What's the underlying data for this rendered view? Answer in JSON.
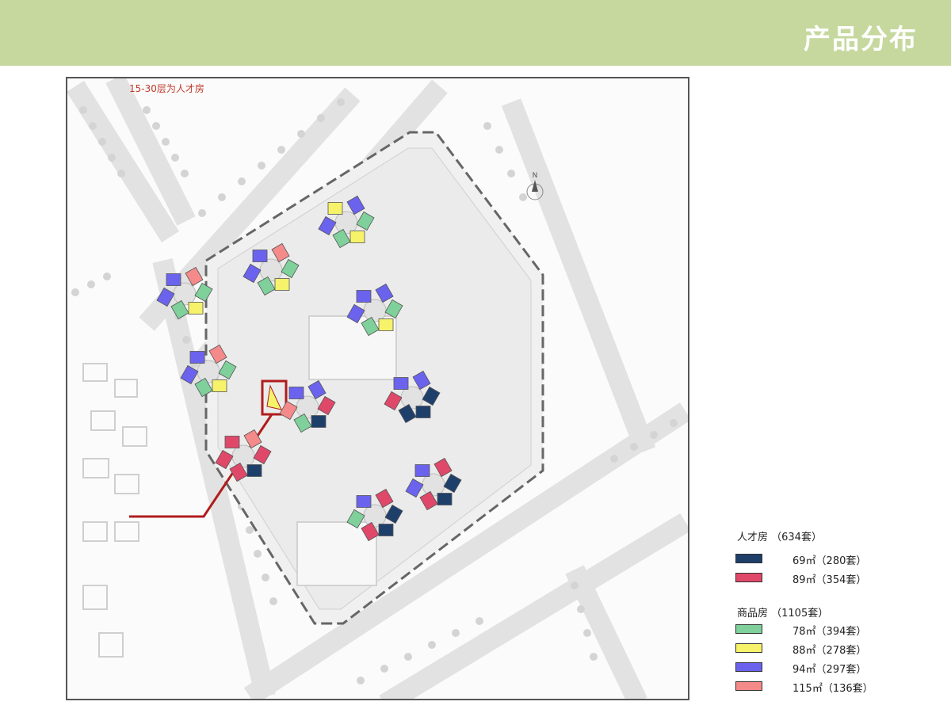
{
  "header": {
    "title": "产品分布",
    "background": "#c6d89e"
  },
  "map": {
    "note": "15-30层为人才房",
    "compass": "N",
    "callout_color": "#b01c1c"
  },
  "legend": {
    "groups": [
      {
        "title": "人才房 （634套）",
        "items": [
          {
            "label": "69㎡（280套）",
            "color": "#1f3f6b"
          },
          {
            "label": "89㎡（354套）",
            "color": "#e0486a"
          }
        ]
      },
      {
        "title": "商品房 （1105套）",
        "items": [
          {
            "label": "78㎡（394套）",
            "color": "#7fd09a"
          },
          {
            "label": "88㎡（278套）",
            "color": "#f6f36a"
          },
          {
            "label": "94㎡（297套）",
            "color": "#6b63ee"
          },
          {
            "label": "115㎡（136套）",
            "color": "#f48a8a"
          }
        ]
      }
    ]
  }
}
